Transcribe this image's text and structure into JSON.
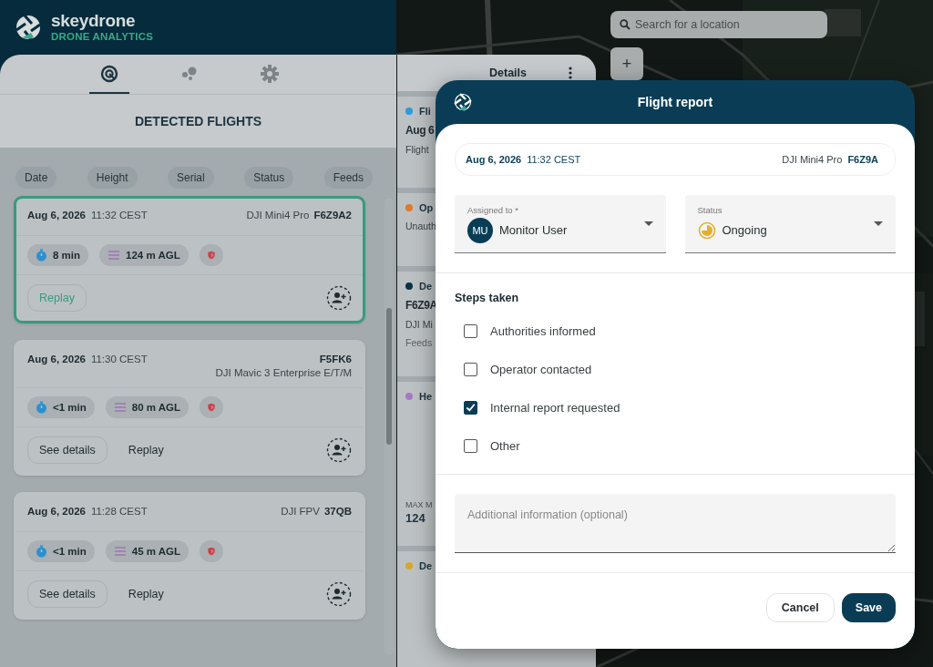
{
  "brand": {
    "name": "skeydrone",
    "subtitle": "DRONE ANALYTICS"
  },
  "nav_tabs": [
    {
      "kind": "target",
      "selected": true
    },
    {
      "kind": "bubbles",
      "selected": false
    },
    {
      "kind": "gear",
      "selected": false
    }
  ],
  "panel_title": "DETECTED FLIGHTS",
  "sort_chips": [
    "Date",
    "Height",
    "Serial",
    "Status",
    "Feeds"
  ],
  "flights": [
    {
      "date": "Aug 6, 2026",
      "time": "11:32 CEST",
      "model": "DJI Mini4 Pro",
      "serial": "F6Z9A2",
      "kind": "inline",
      "duration": "8 min",
      "height": "124 m AGL",
      "selected": true,
      "buttons": [
        {
          "label": "Replay",
          "kind": "outlined"
        }
      ]
    },
    {
      "date": "Aug 6, 2026",
      "time": "11:30 CEST",
      "model": "DJI Mavic 3 Enterprise E/T/M",
      "serial": "F5FK6",
      "kind": "stacked",
      "duration": "<1 min",
      "height": "80 m AGL",
      "selected": false,
      "buttons": [
        {
          "label": "See details",
          "kind": "outlined"
        },
        {
          "label": "Replay",
          "kind": "text"
        }
      ]
    },
    {
      "date": "Aug 6, 2026",
      "time": "11:28 CEST",
      "model": "DJI FPV",
      "serial": "37QB",
      "kind": "inline",
      "duration": "<1 min",
      "height": "45 m AGL",
      "selected": false,
      "buttons": [
        {
          "label": "See details",
          "kind": "outlined"
        },
        {
          "label": "Replay",
          "kind": "text"
        }
      ]
    }
  ],
  "details": {
    "title": "Details",
    "sections": [
      {
        "color": "#2d9bd6",
        "heading": "Fli",
        "lines": [
          {
            "text": "Aug 6",
            "kind": "strong"
          },
          {
            "text": "Flight",
            "kind": "plain"
          }
        ]
      },
      {
        "color": "#d97a2e",
        "heading": "Op",
        "lines": [
          {
            "text": "Unauth",
            "kind": "plain"
          }
        ]
      },
      {
        "color": "#0b3145",
        "heading": "De",
        "lines": [
          {
            "text": "F6Z9A",
            "kind": "strong"
          },
          {
            "text": "DJI Mi",
            "kind": "plain"
          },
          {
            "text": "Feeds",
            "kind": "muted"
          }
        ]
      },
      {
        "color": "#a878c8",
        "heading": "He",
        "lines": [
          {
            "text": "MAX M",
            "kind": "caption"
          },
          {
            "text": "124",
            "kind": "value"
          }
        ]
      },
      {
        "color": "#d4a82a",
        "heading": "De"
      }
    ]
  },
  "map": {
    "search_placeholder": "Search for a location",
    "zoom_in": "+"
  },
  "modal": {
    "title": "Flight report",
    "date": "Aug 6, 2026",
    "time": "11:32 CEST",
    "model": "DJI Mini4 Pro",
    "serial": "F6Z9A",
    "assigned": {
      "label": "Assigned to *",
      "initials": "MU",
      "value": "Monitor User"
    },
    "status": {
      "label": "Status",
      "value": "Ongoing"
    },
    "steps_title": "Steps taken",
    "steps": [
      {
        "label": "Authorities informed",
        "checked": false
      },
      {
        "label": "Operator contacted",
        "checked": false
      },
      {
        "label": "Internal report requested",
        "checked": true
      },
      {
        "label": "Other",
        "checked": false
      }
    ],
    "notes_placeholder": "Additional information (optional)",
    "buttons": [
      {
        "label": "Cancel",
        "kind": "secondary"
      },
      {
        "label": "Save",
        "kind": "primary"
      }
    ]
  }
}
